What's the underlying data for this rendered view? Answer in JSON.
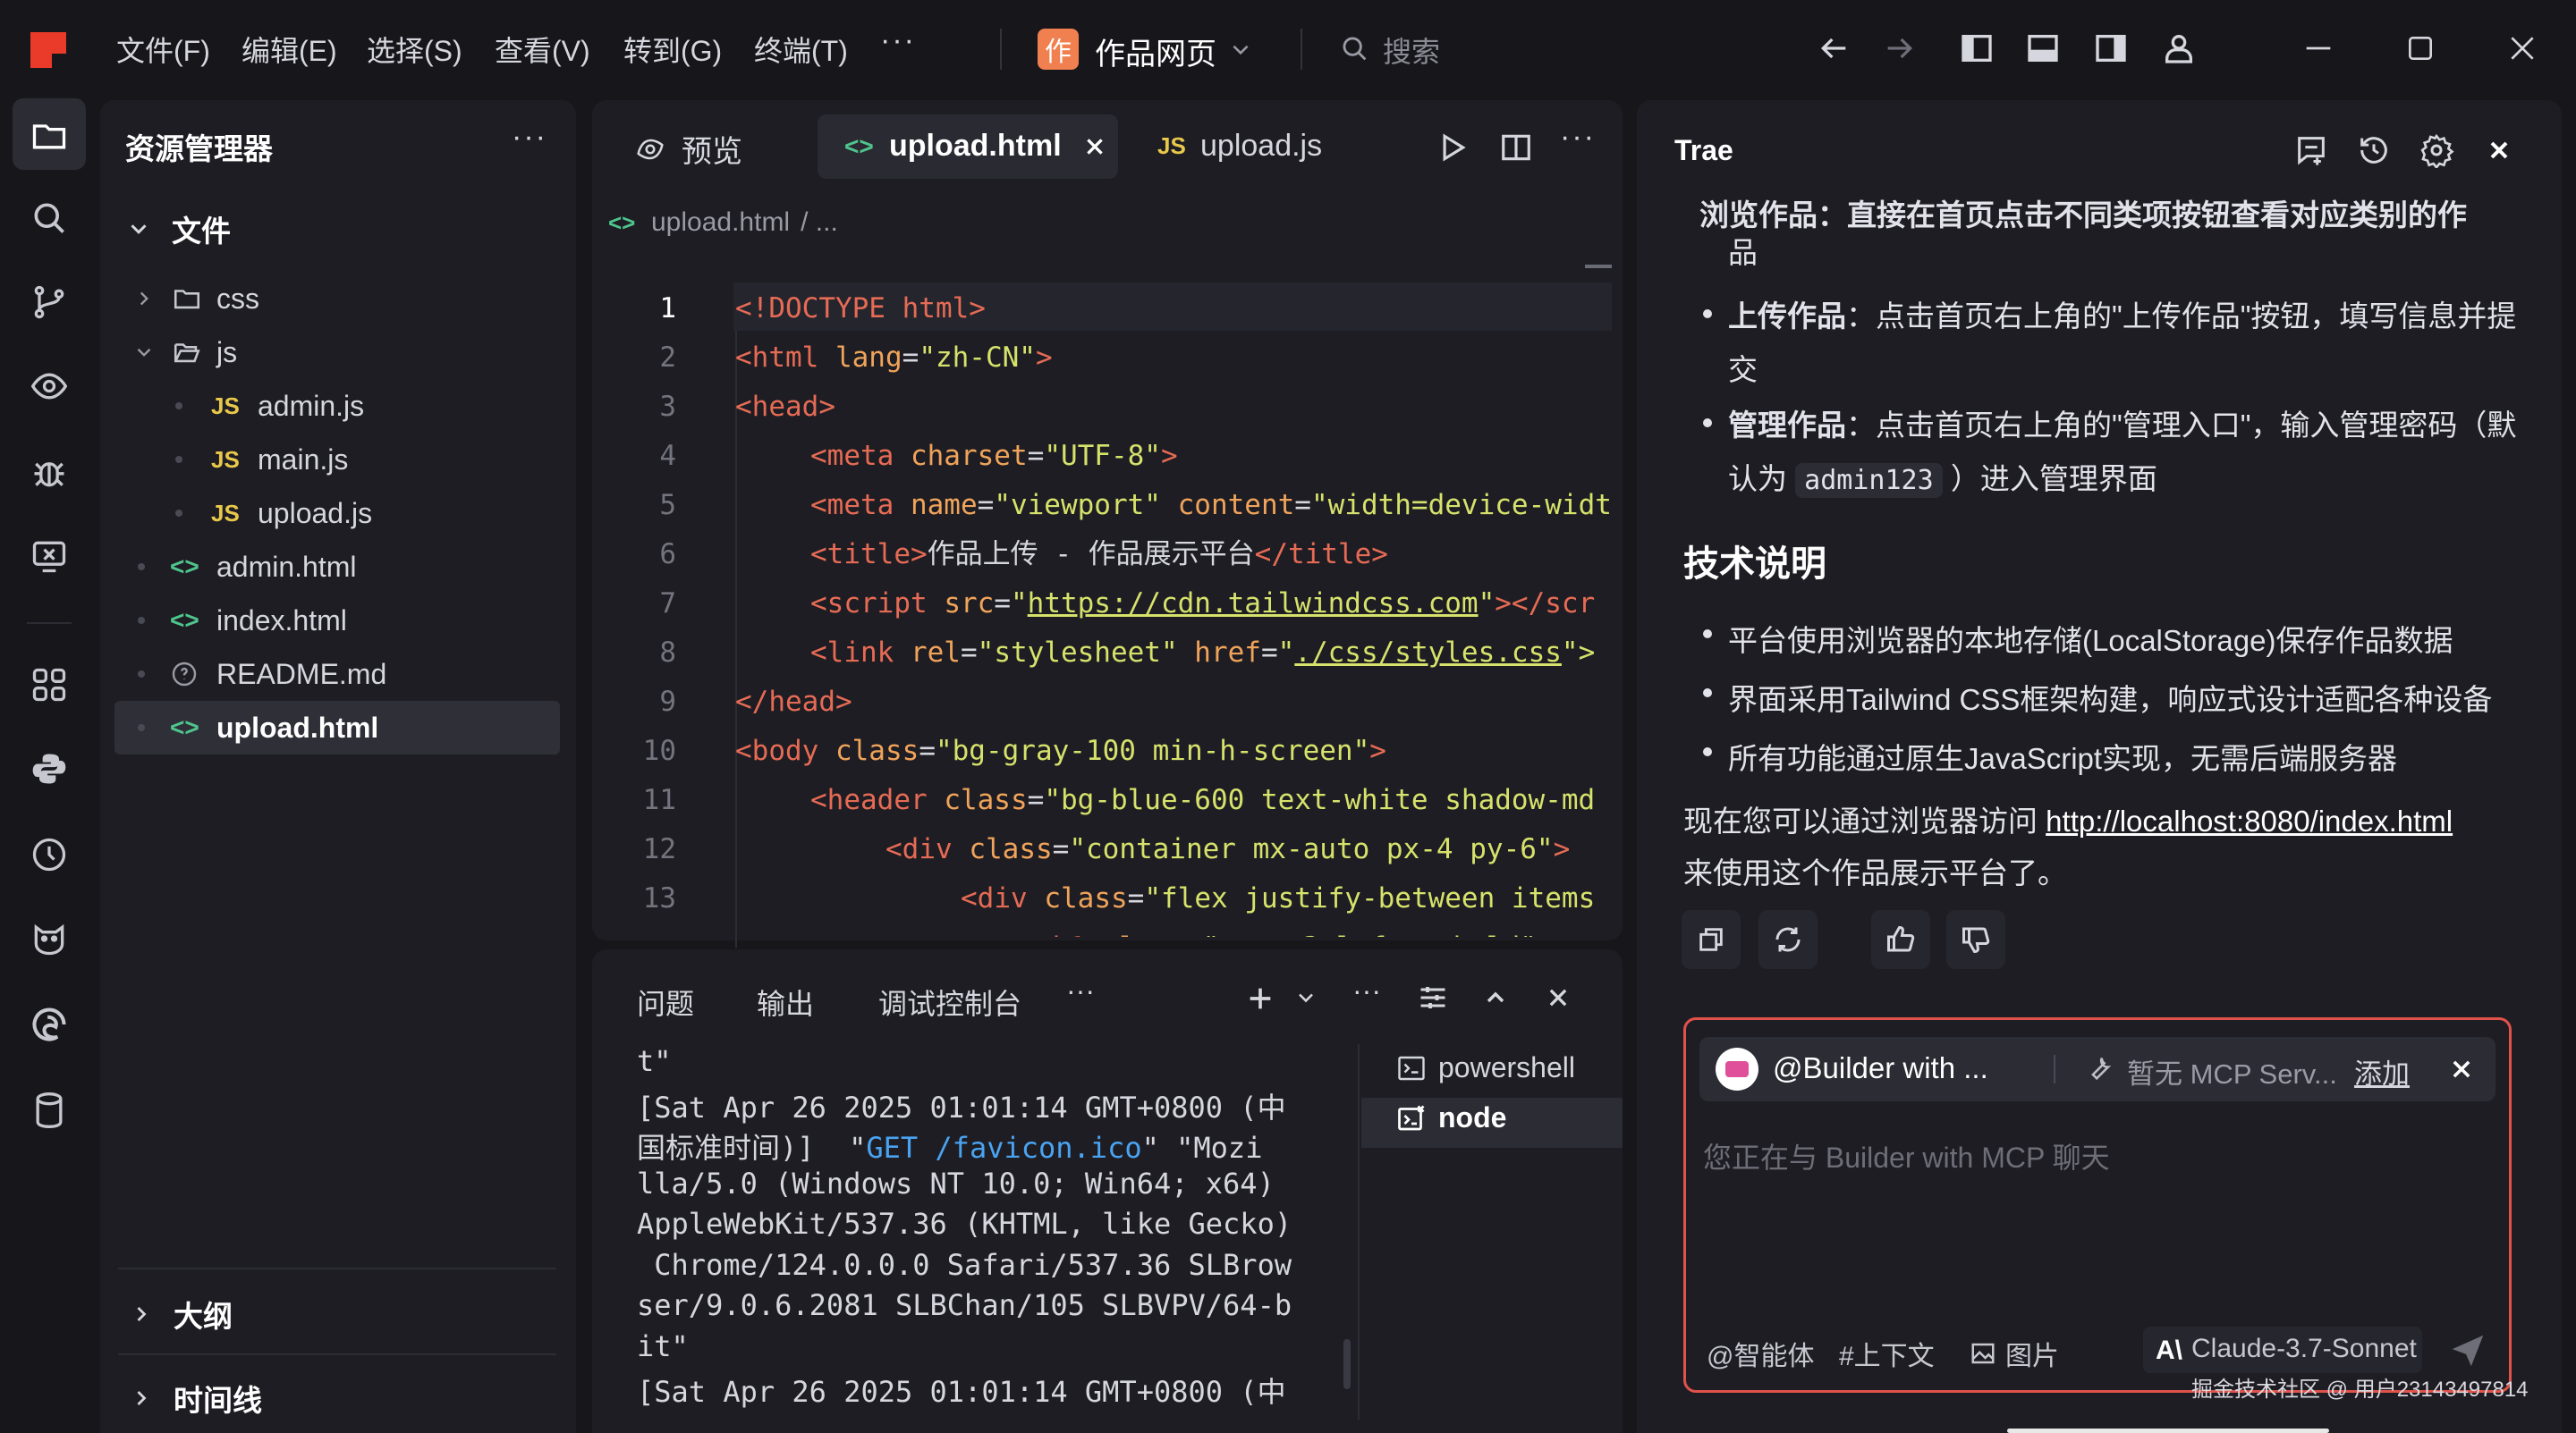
{
  "menu": [
    "文件(F)",
    "编辑(E)",
    "选择(S)",
    "查看(V)",
    "转到(G)",
    "终端(T)"
  ],
  "menu_more": "···",
  "project": {
    "badge": "作",
    "name": "作品网页"
  },
  "search": {
    "placeholder": "搜索"
  },
  "explorer": {
    "title": "资源管理器",
    "more": "···",
    "root": "文件",
    "items": [
      {
        "label": "css",
        "kind": "folder"
      },
      {
        "label": "js",
        "kind": "folder-open"
      },
      {
        "label": "admin.js",
        "kind": "js"
      },
      {
        "label": "main.js",
        "kind": "js"
      },
      {
        "label": "upload.js",
        "kind": "js"
      },
      {
        "label": "admin.html",
        "kind": "html"
      },
      {
        "label": "index.html",
        "kind": "html"
      },
      {
        "label": "README.md",
        "kind": "md"
      },
      {
        "label": "upload.html",
        "kind": "html",
        "selected": true
      }
    ],
    "js_tag": "JS",
    "html_tag": "<>",
    "outline": "大纲",
    "timeline": "时间线"
  },
  "editor": {
    "tabs": [
      {
        "label": "预览"
      },
      {
        "label": "upload.html",
        "active": true
      },
      {
        "label": "upload.js"
      }
    ],
    "breadcrumb": {
      "file": "upload.html",
      "rest": "/ ..."
    },
    "line_numbers": [
      "1",
      "2",
      "3",
      "4",
      "5",
      "6",
      "7",
      "8",
      "9",
      "10",
      "11",
      "12",
      "13"
    ],
    "current_line": 1
  },
  "panel": {
    "tabs": [
      "问题",
      "输出",
      "调试控制台"
    ],
    "terminal_lines": [
      "t\"",
      "[Sat Apr 26 2025 01:01:14 GMT+0800 (中",
      "国标准时间)]  \"GET /favicon.ico\" \"Mozi",
      "lla/5.0 (Windows NT 10.0; Win64; x64)",
      "AppleWebKit/537.36 (KHTML, like Gecko)",
      " Chrome/124.0.0.0 Safari/537.36 SLBrow",
      "ser/9.0.6.2081 SLBChan/105 SLBVPV/64-b",
      "it\"",
      "[Sat Apr 26 2025 01:01:14 GMT+0800 (中"
    ],
    "sessions": [
      {
        "label": "powershell"
      },
      {
        "label": "node",
        "active": true
      }
    ]
  },
  "chat": {
    "title": "Trae",
    "partial_top": "浏览作品：直接在首页点击不同类项按钮查看对应类别的作",
    "partial_top_cont": "品",
    "upload": {
      "bold": "上传作品",
      "text": "：点击首页右上角的\"上传作品\"按钮，填写信息并提",
      "cont": "交"
    },
    "manage": {
      "bold": "管理作品",
      "text": "：点击首页右上角的\"管理入口\"，输入管理密码（默",
      "cont_pre": "认为",
      "code": "admin123",
      "cont_post": "）进入管理界面"
    },
    "heading": "技术说明",
    "tech": [
      "平台使用浏览器的本地存储(LocalStorage)保存作品数据",
      "界面采用Tailwind CSS框架构建，响应式设计适配各种设备",
      "所有功能通过原生JavaScript实现，无需后端服务器"
    ],
    "closing_pre": "现在您可以通过浏览器访问 ",
    "closing_link": "http://localhost:8080/index.html",
    "closing_post": "来使用这个作品展示平台了。",
    "agent": "@Builder with ...",
    "mcp": "暂无 MCP Serv...",
    "mcp_add": "添加",
    "input_placeholder": "您正在与 Builder with MCP 聊天",
    "footer": {
      "agent": "@智能体",
      "context": "#上下文",
      "image": "图片",
      "model": "Claude-3.7-Sonnet"
    },
    "watermark": "掘金技术社区 @ 用户23143497814"
  },
  "colors": {
    "accent_red": "#e0524a",
    "logo": "#ea3a2a",
    "project_badge": "#f08050"
  }
}
